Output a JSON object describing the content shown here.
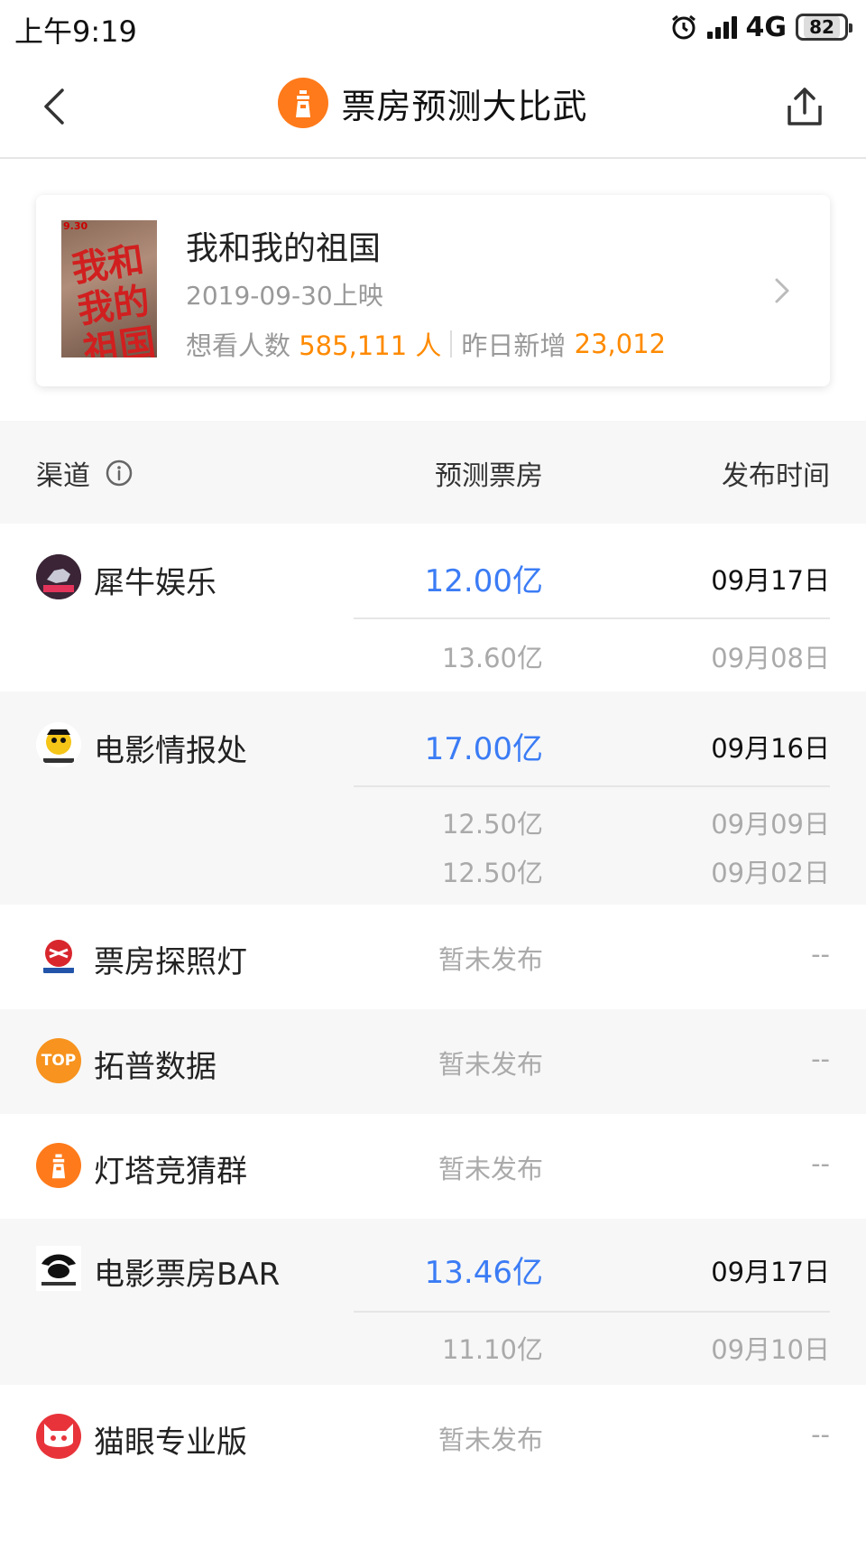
{
  "status_bar": {
    "time": "上午9:19",
    "network": "4G",
    "battery": "82"
  },
  "nav": {
    "title": "票房预测大比武",
    "back_icon": "chevron-left-icon",
    "share_icon": "share-icon"
  },
  "movie": {
    "title": "我和我的祖国",
    "release": "2019-09-30上映",
    "want_label": "想看人数",
    "want_value": "585,111 人",
    "new_label": "昨日新增",
    "new_value": "23,012",
    "poster_title": "我和我的祖国",
    "poster_date": "9.30"
  },
  "table": {
    "col_channel": "渠道",
    "col_forecast": "预测票房",
    "col_date": "发布时间"
  },
  "rows": [
    {
      "name": "犀牛娱乐",
      "value": "12.00亿",
      "date": "09月17日",
      "history": [
        {
          "value": "13.60亿",
          "date": "09月08日"
        }
      ]
    },
    {
      "name": "电影情报处",
      "value": "17.00亿",
      "date": "09月16日",
      "history": [
        {
          "value": "12.50亿",
          "date": "09月09日"
        },
        {
          "value": "12.50亿",
          "date": "09月02日"
        }
      ]
    },
    {
      "name": "票房探照灯",
      "value": "暂未发布",
      "date": "--"
    },
    {
      "name": "拓普数据",
      "value": "暂未发布",
      "date": "--",
      "logo_text": "TOP"
    },
    {
      "name": "灯塔竞猜群",
      "value": "暂未发布",
      "date": "--"
    },
    {
      "name": "电影票房BAR",
      "value": "13.46亿",
      "date": "09月17日",
      "history": [
        {
          "value": "11.10亿",
          "date": "09月10日"
        }
      ]
    },
    {
      "name": "猫眼专业版",
      "value": "暂未发布",
      "date": "--"
    }
  ],
  "colors": {
    "accent_orange": "#ff8a00",
    "forecast_blue": "#3b7cf5",
    "lighthouse_orange": "#ff7a1a",
    "maoyan_red": "#e8333a"
  }
}
